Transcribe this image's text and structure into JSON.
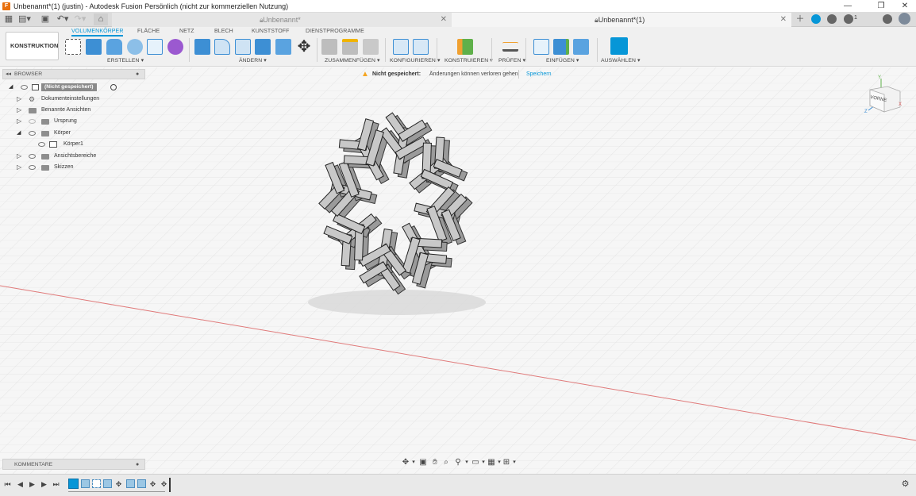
{
  "window": {
    "title": "Unbenannt*(1) (justin) - Autodesk Fusion Persönlich (nicht zur kommerziellen Nutzung)",
    "minimize": "—",
    "restore": "❐",
    "close": "✕"
  },
  "tabs": [
    {
      "label": "Unbenannt*",
      "active": false
    },
    {
      "label": "Unbenannt*(1)",
      "active": true
    }
  ],
  "tabbar": {
    "add_icon": "plus-icon",
    "notification_count": "1"
  },
  "toolbar": {
    "workspace": "KONSTRUKTION",
    "workspace_tabs": [
      "VOLUMENKÖRPER",
      "FLÄCHE",
      "NETZ",
      "BLECH",
      "KUNSTSTOFF",
      "DIENSTPROGRAMME"
    ],
    "groups": [
      "ERSTELLEN",
      "ÄNDERN",
      "ZUSAMMENFÜGEN",
      "KONFIGURIEREN",
      "KONSTRUIEREN",
      "PRÜFEN",
      "EINFÜGEN",
      "AUSWÄHLEN"
    ]
  },
  "browser": {
    "header": "BROWSER",
    "root": "(Nicht gespeichert)",
    "items": [
      {
        "label": "Dokumenteinstellungen"
      },
      {
        "label": "Benannte Ansichten"
      },
      {
        "label": "Ursprung"
      },
      {
        "label": "Körper"
      },
      {
        "label": "Körper1"
      },
      {
        "label": "Ansichtsbereiche"
      },
      {
        "label": "Skizzen"
      }
    ]
  },
  "notice": {
    "title": "Nicht gespeichert:",
    "message": "Änderungen können verloren gehen",
    "action": "Speichern"
  },
  "comments": {
    "header": "KOMMENTARE"
  },
  "viewcube": {
    "face": "VORNE",
    "axes": {
      "x": "X",
      "y": "Y",
      "z": "Z"
    }
  },
  "colors": {
    "accent": "#0696d7",
    "toolbar_bg": "#f0f0f0",
    "warning": "#f5a623",
    "model": "#c8c8c8",
    "x_axis": "#e05c5c"
  }
}
